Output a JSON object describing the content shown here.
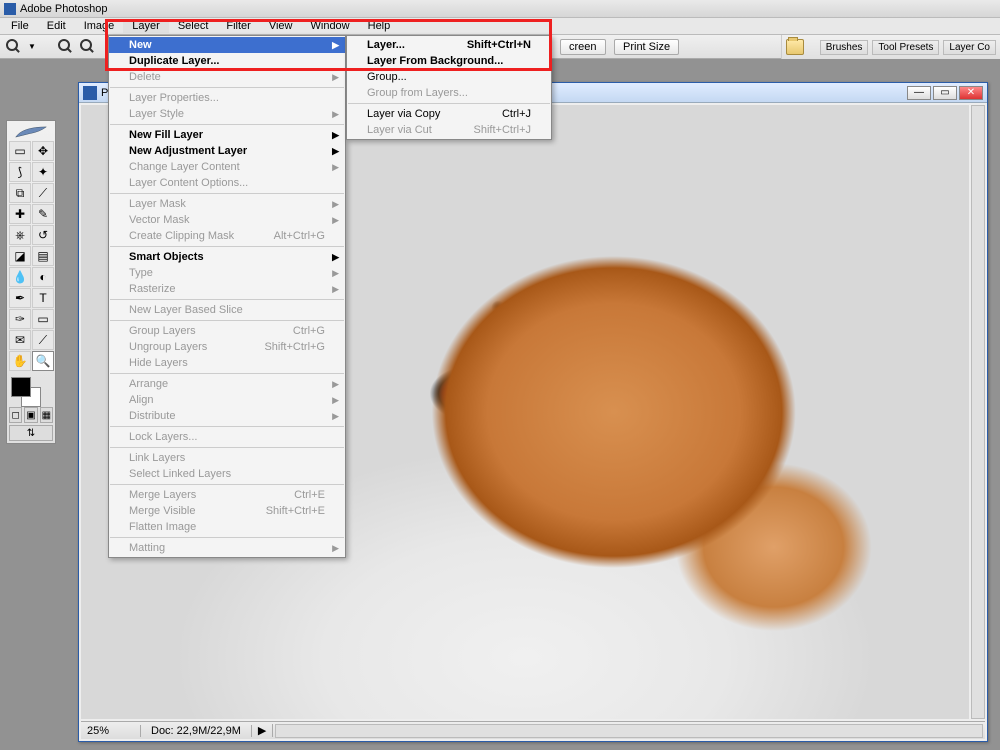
{
  "app": {
    "title": "Adobe Photoshop"
  },
  "menubar": [
    "File",
    "Edit",
    "Image",
    "Layer",
    "Select",
    "Filter",
    "View",
    "Window",
    "Help"
  ],
  "optionbar": {
    "screen_btn": "creen",
    "print_btn": "Print Size",
    "tabs": [
      "Brushes",
      "Tool Presets",
      "Layer Co"
    ]
  },
  "docwin": {
    "title_letter": "P",
    "min": "—",
    "max": "▭",
    "close": "✕",
    "zoom": "25%",
    "doc_info": "Doc: 22,9M/22,9M",
    "arrow": "▶"
  },
  "layer_menu": [
    {
      "label": "New",
      "highlight": true,
      "sub": true,
      "bold": true
    },
    {
      "label": "Duplicate Layer...",
      "bold": true
    },
    {
      "label": "Delete",
      "disabled": true,
      "sub": true
    },
    {
      "sep": true
    },
    {
      "label": "Layer Properties...",
      "disabled": true
    },
    {
      "label": "Layer Style",
      "disabled": true,
      "sub": true
    },
    {
      "sep": true
    },
    {
      "label": "New Fill Layer",
      "bold": true,
      "sub": true
    },
    {
      "label": "New Adjustment Layer",
      "bold": true,
      "sub": true
    },
    {
      "label": "Change Layer Content",
      "disabled": true,
      "sub": true
    },
    {
      "label": "Layer Content Options...",
      "disabled": true
    },
    {
      "sep": true
    },
    {
      "label": "Layer Mask",
      "disabled": true,
      "sub": true
    },
    {
      "label": "Vector Mask",
      "disabled": true,
      "sub": true
    },
    {
      "label": "Create Clipping Mask",
      "disabled": true,
      "shortcut": "Alt+Ctrl+G"
    },
    {
      "sep": true
    },
    {
      "label": "Smart Objects",
      "bold": true,
      "sub": true
    },
    {
      "label": "Type",
      "disabled": true,
      "sub": true
    },
    {
      "label": "Rasterize",
      "disabled": true,
      "sub": true
    },
    {
      "sep": true
    },
    {
      "label": "New Layer Based Slice",
      "disabled": true
    },
    {
      "sep": true
    },
    {
      "label": "Group Layers",
      "disabled": true,
      "shortcut": "Ctrl+G"
    },
    {
      "label": "Ungroup Layers",
      "disabled": true,
      "shortcut": "Shift+Ctrl+G"
    },
    {
      "label": "Hide Layers",
      "disabled": true
    },
    {
      "sep": true
    },
    {
      "label": "Arrange",
      "disabled": true,
      "sub": true
    },
    {
      "label": "Align",
      "disabled": true,
      "sub": true
    },
    {
      "label": "Distribute",
      "disabled": true,
      "sub": true
    },
    {
      "sep": true
    },
    {
      "label": "Lock Layers...",
      "disabled": true
    },
    {
      "sep": true
    },
    {
      "label": "Link Layers",
      "disabled": true
    },
    {
      "label": "Select Linked Layers",
      "disabled": true
    },
    {
      "sep": true
    },
    {
      "label": "Merge Layers",
      "disabled": true,
      "shortcut": "Ctrl+E"
    },
    {
      "label": "Merge Visible",
      "disabled": true,
      "shortcut": "Shift+Ctrl+E"
    },
    {
      "label": "Flatten Image",
      "disabled": true
    },
    {
      "sep": true
    },
    {
      "label": "Matting",
      "disabled": true,
      "sub": true
    }
  ],
  "new_submenu": [
    {
      "label": "Layer...",
      "shortcut": "Shift+Ctrl+N",
      "bold": true
    },
    {
      "label": "Layer From Background...",
      "bold": true
    },
    {
      "label": "Group..."
    },
    {
      "label": "Group from Layers...",
      "disabled": true
    },
    {
      "sep": true
    },
    {
      "label": "Layer via Copy",
      "shortcut": "Ctrl+J"
    },
    {
      "label": "Layer via Cut",
      "disabled": true,
      "shortcut": "Shift+Ctrl+J"
    }
  ],
  "tools": [
    {
      "n": "marquee",
      "g": "▭"
    },
    {
      "n": "move",
      "g": "✥"
    },
    {
      "n": "lasso",
      "g": "⟆"
    },
    {
      "n": "wand",
      "g": "✦"
    },
    {
      "n": "crop",
      "g": "⧉"
    },
    {
      "n": "slice",
      "g": "⟋"
    },
    {
      "n": "heal",
      "g": "✚"
    },
    {
      "n": "brush",
      "g": "✎"
    },
    {
      "n": "stamp",
      "g": "⎈"
    },
    {
      "n": "history",
      "g": "↺"
    },
    {
      "n": "eraser",
      "g": "◪"
    },
    {
      "n": "gradient",
      "g": "▤"
    },
    {
      "n": "blur",
      "g": "💧"
    },
    {
      "n": "dodge",
      "g": "◐"
    },
    {
      "n": "path",
      "g": "✒"
    },
    {
      "n": "type",
      "g": "T"
    },
    {
      "n": "pen",
      "g": "✑"
    },
    {
      "n": "shape",
      "g": "▭"
    },
    {
      "n": "notes",
      "g": "✉"
    },
    {
      "n": "eyedrop",
      "g": "⟋"
    },
    {
      "n": "hand",
      "g": "✋"
    },
    {
      "n": "zoom",
      "g": "🔍",
      "sel": true
    }
  ],
  "mode_btns": [
    "◻",
    "▣",
    "▦"
  ]
}
